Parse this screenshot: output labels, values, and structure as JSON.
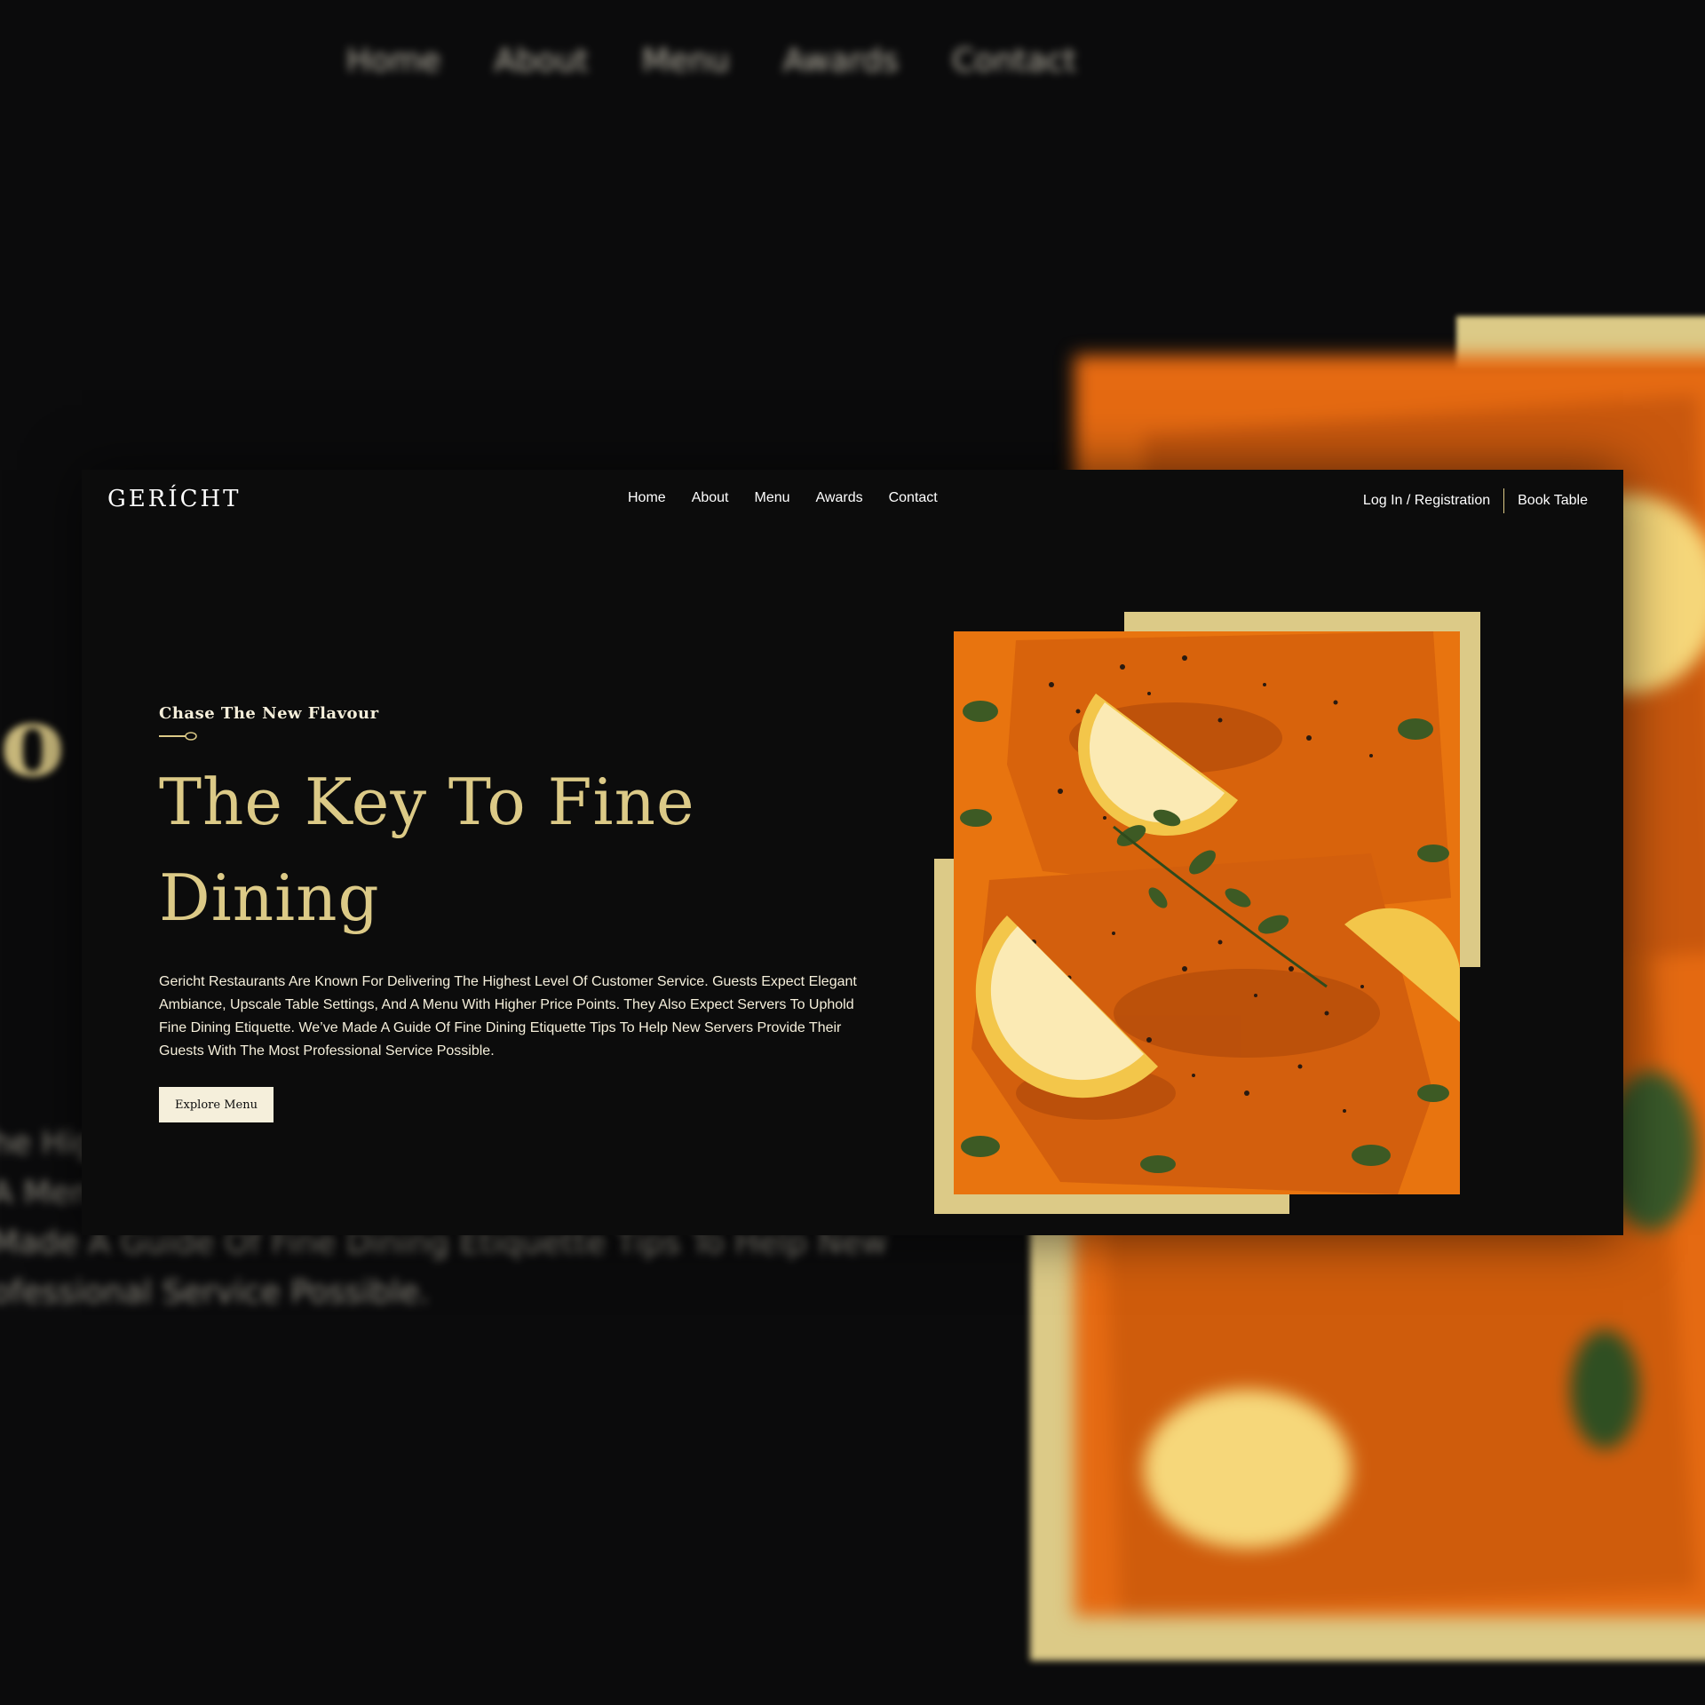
{
  "background": {
    "nav_items": [
      "Home",
      "About",
      "Menu",
      "Awards",
      "Contact"
    ],
    "big_letter": "o",
    "paragraph_lines": [
      "he Hig",
      "A Men",
      "Made A Guide Of Fine Dining Etiquette Tips To Help New",
      "ofessional Service Possible."
    ]
  },
  "brand": {
    "logo": "GERÍCHT"
  },
  "nav": {
    "links": [
      "Home",
      "About",
      "Menu",
      "Awards",
      "Contact"
    ],
    "login": "Log In / Registration",
    "book": "Book Table"
  },
  "hero": {
    "subtitle": "Chase The New Flavour",
    "title": "The Key To Fine Dining",
    "description": "Gericht Restaurants Are Known For Delivering The Highest Level Of Customer Service. Guests Expect Elegant Ambiance, Upscale Table Settings, And A Menu With Higher Price Points. They Also Expect Servers To Uphold Fine Dining Etiquette. We’ve Made A Guide Of Fine Dining Etiquette Tips To Help New Servers Provide Their Guests With The Most Professional Service Possible.",
    "button": "Explore Menu"
  },
  "image": {
    "subject": "salmon-dish-with-lemon-and-oregano"
  },
  "colors": {
    "gold": "#dcca87",
    "cream": "#f5efdb",
    "black": "#0c0c0c",
    "sauce": "#e56a12"
  }
}
